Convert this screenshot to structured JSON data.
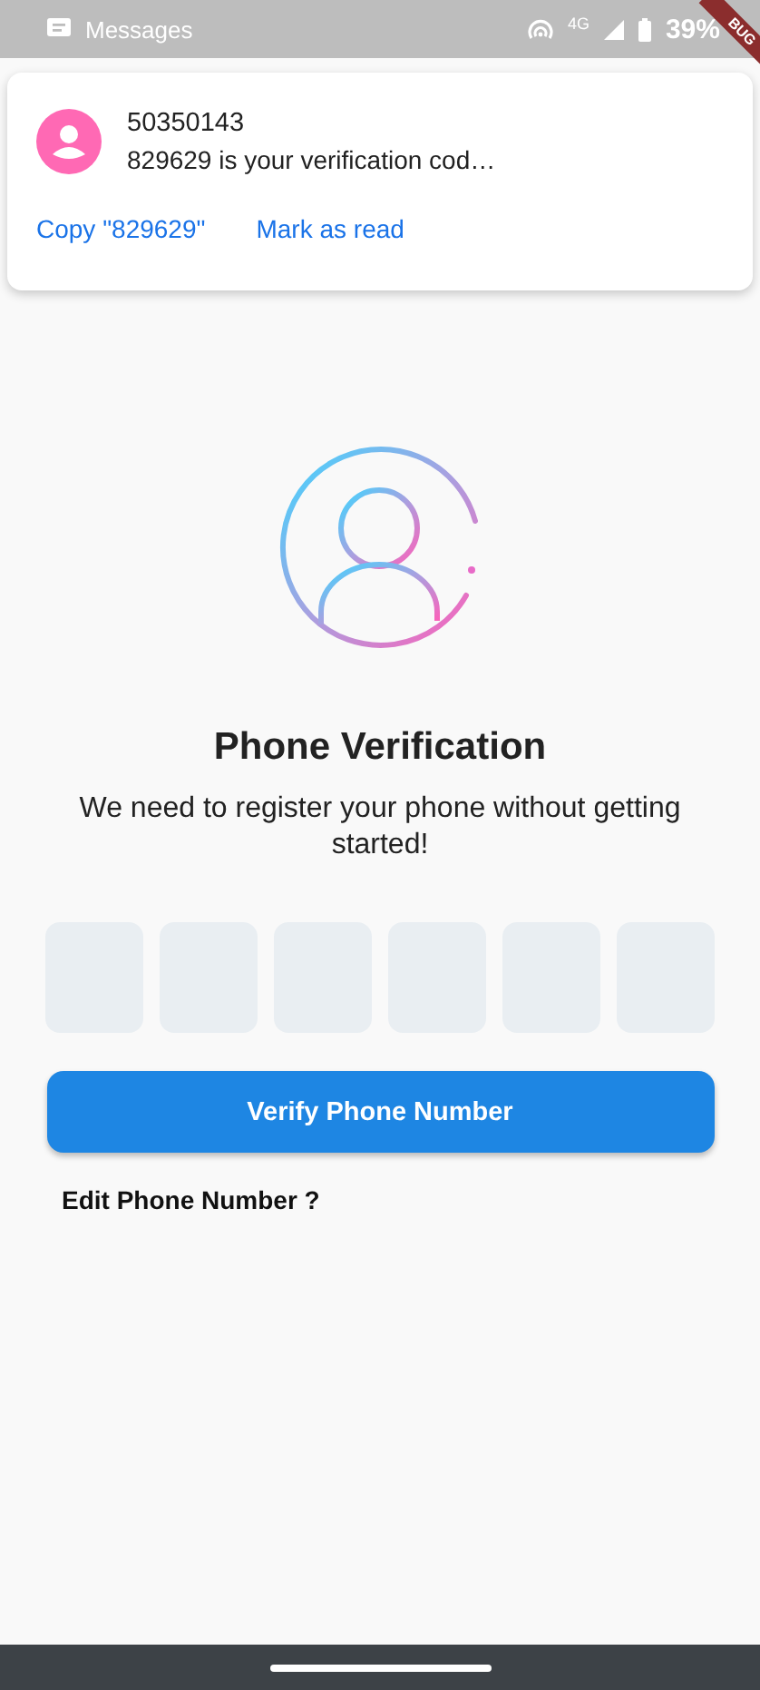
{
  "status_bar": {
    "app": "Messages",
    "network": "4G",
    "battery": "39%"
  },
  "debug_ribbon": "BUG",
  "notification": {
    "sender": "50350143",
    "message": "829629 is your verification cod…",
    "actions": [
      "Copy \"829629\"",
      "Mark as read"
    ]
  },
  "title": "Phone Verification",
  "subtitle": "We need to register your phone without getting started!",
  "code_boxes": [
    {
      "kind": "empty"
    },
    {
      "kind": "empty"
    },
    {
      "kind": "empty"
    },
    {
      "kind": "empty"
    },
    {
      "kind": "empty"
    },
    {
      "kind": "empty"
    }
  ],
  "verify_button": "Verify Phone Number",
  "edit_link": "Edit Phone Number ?"
}
